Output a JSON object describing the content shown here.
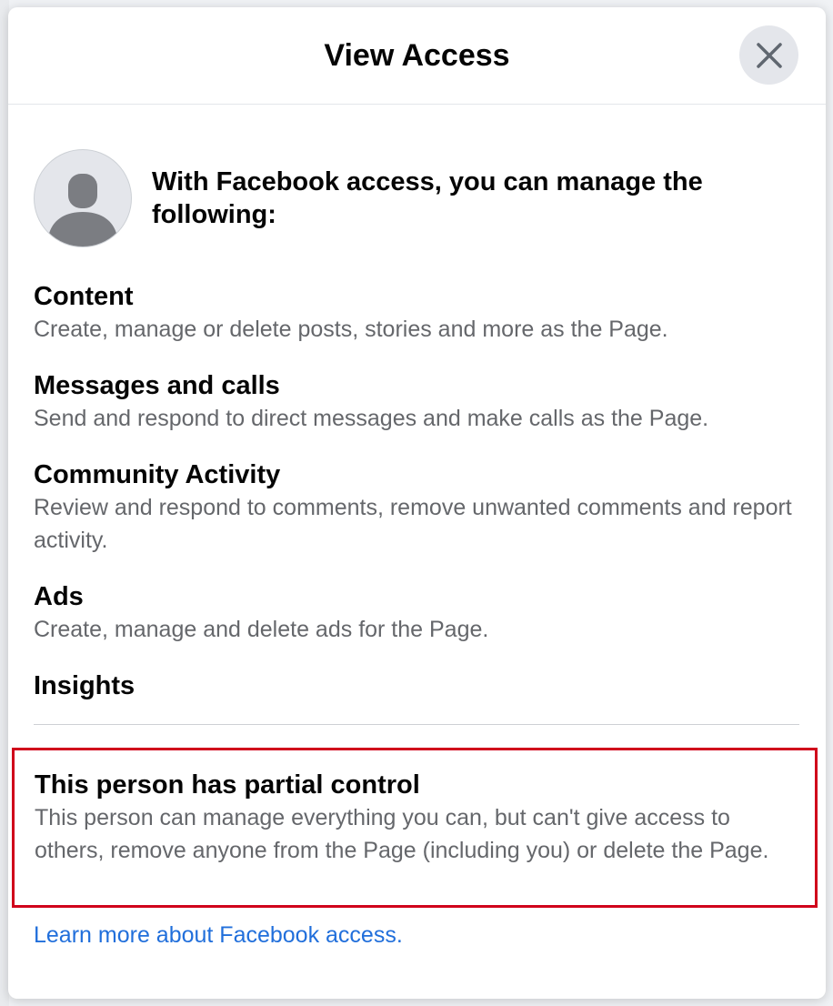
{
  "dialog": {
    "title": "View Access",
    "intro": "With Facebook access, you can manage the following:"
  },
  "permissions": [
    {
      "title": "Content",
      "description": "Create, manage or delete posts, stories and more as the Page."
    },
    {
      "title": "Messages and calls",
      "description": "Send and respond to direct messages and make calls as the Page."
    },
    {
      "title": "Community Activity",
      "description": "Review and respond to comments, remove unwanted comments and report activity."
    },
    {
      "title": "Ads",
      "description": "Create, manage and delete ads for the Page."
    },
    {
      "title": "Insights",
      "description": ""
    }
  ],
  "control": {
    "title": "This person has partial control",
    "description": "This person can manage everything you can, but can't give access to others, remove anyone from the Page (including you) or delete the Page."
  },
  "footer": {
    "learn_more": "Learn more about Facebook access."
  },
  "icons": {
    "close": "close-icon",
    "avatar": "avatar-placeholder-icon"
  },
  "colors": {
    "highlight_border": "#d0021b",
    "link": "#216fdb",
    "secondary_text": "#65676b"
  }
}
